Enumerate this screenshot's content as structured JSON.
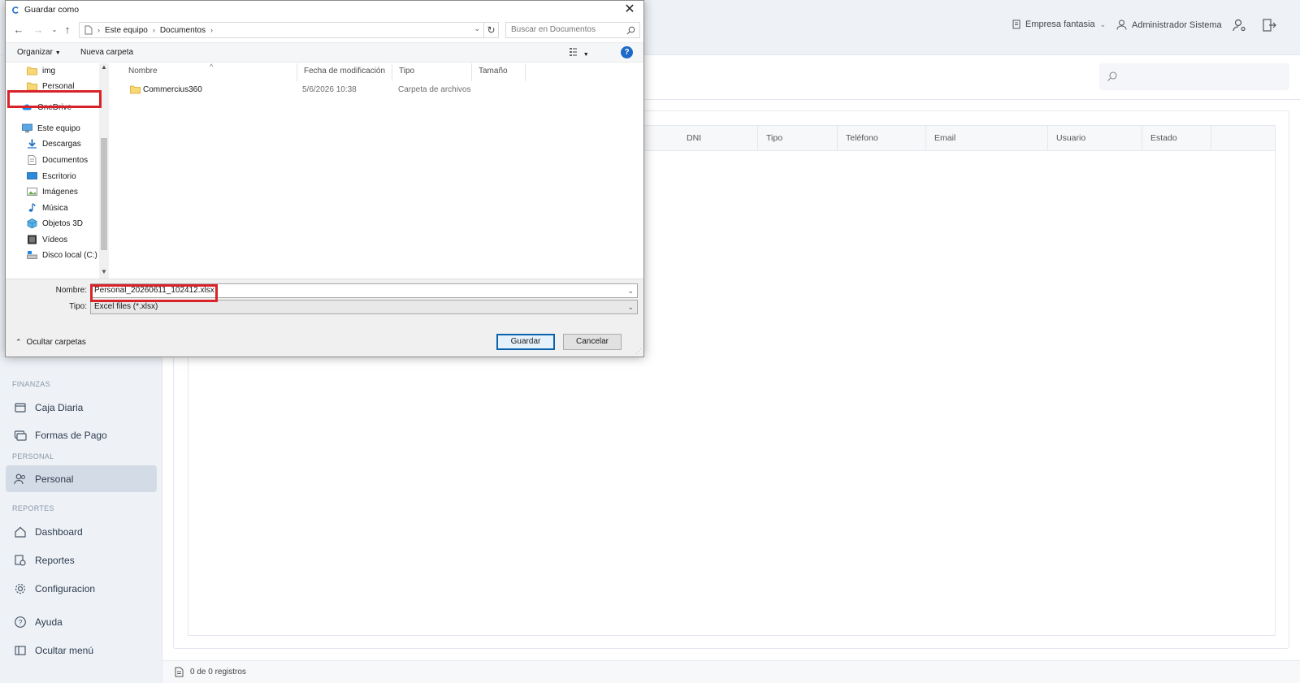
{
  "app": {
    "header": {
      "company": "Empresa fantasia",
      "user": "Administrador Sistema"
    },
    "sidebar": {
      "partial_item_label": "…",
      "sections": [
        {
          "title": "FINANZAS",
          "items": [
            {
              "label": "Caja Diaria",
              "icon": "cash-register-icon"
            },
            {
              "label": "Formas de Pago",
              "icon": "payment-methods-icon"
            }
          ]
        },
        {
          "title": "PERSONAL",
          "items": [
            {
              "label": "Personal",
              "icon": "users-icon",
              "active": true
            }
          ]
        },
        {
          "title": "REPORTES",
          "items": [
            {
              "label": "Dashboard",
              "icon": "home-icon"
            },
            {
              "label": "Reportes",
              "icon": "reports-icon"
            },
            {
              "label": "Configuracion",
              "icon": "gear-icon"
            }
          ]
        }
      ],
      "bottom": [
        {
          "label": "Ayuda",
          "icon": "help-icon"
        },
        {
          "label": "Ocultar menú",
          "icon": "collapse-menu-icon"
        }
      ]
    },
    "table": {
      "columns": [
        "DNI",
        "Tipo",
        "Teléfono",
        "Email",
        "Usuario",
        "Estado"
      ]
    },
    "footer": {
      "records": "0 de 0 registros"
    }
  },
  "dialog": {
    "title": "Guardar como",
    "breadcrumb": [
      "Este equipo",
      "Documentos"
    ],
    "search_placeholder": "Buscar en Documentos",
    "commands": {
      "organize": "Organizar",
      "new_folder": "Nueva carpeta"
    },
    "tree": [
      {
        "label": "img",
        "icon": "folder-icon",
        "indent": 1
      },
      {
        "label": "Personal",
        "icon": "folder-icon",
        "indent": 1
      },
      {
        "label": "OneDrive",
        "icon": "cloud-icon",
        "indent": 0
      },
      {
        "label": "Este equipo",
        "icon": "computer-icon",
        "indent": 0
      },
      {
        "label": "Descargas",
        "icon": "download-icon",
        "indent": 1
      },
      {
        "label": "Documentos",
        "icon": "documents-icon",
        "indent": 1,
        "selected": true
      },
      {
        "label": "Escritorio",
        "icon": "desktop-icon",
        "indent": 1
      },
      {
        "label": "Imágenes",
        "icon": "pictures-icon",
        "indent": 1
      },
      {
        "label": "Música",
        "icon": "music-icon",
        "indent": 1
      },
      {
        "label": "Objetos 3D",
        "icon": "cube-icon",
        "indent": 1
      },
      {
        "label": "Vídeos",
        "icon": "video-icon",
        "indent": 1
      },
      {
        "label": "Disco local (C:)",
        "icon": "drive-icon",
        "indent": 1
      }
    ],
    "file_columns": {
      "name": "Nombre",
      "modified": "Fecha de modificación",
      "type": "Tipo",
      "size": "Tamaño"
    },
    "files": [
      {
        "name": "Commercius360",
        "modified": "5/6/2026 10:38",
        "type": "Carpeta de archivos",
        "size": ""
      }
    ],
    "filename_label": "Nombre:",
    "filename": "Personal_20260611_102412.xlsx",
    "filetype_label": "Tipo:",
    "filetype": "Excel files (*.xlsx)",
    "hide_folders": "Ocultar carpetas",
    "save_button": "Guardar",
    "cancel_button": "Cancelar"
  },
  "colors": {
    "highlight": "#d9232a",
    "accent": "#0a64ad",
    "sidebar_bg": "#eef2f7",
    "active_item": "#d3dbe6"
  }
}
